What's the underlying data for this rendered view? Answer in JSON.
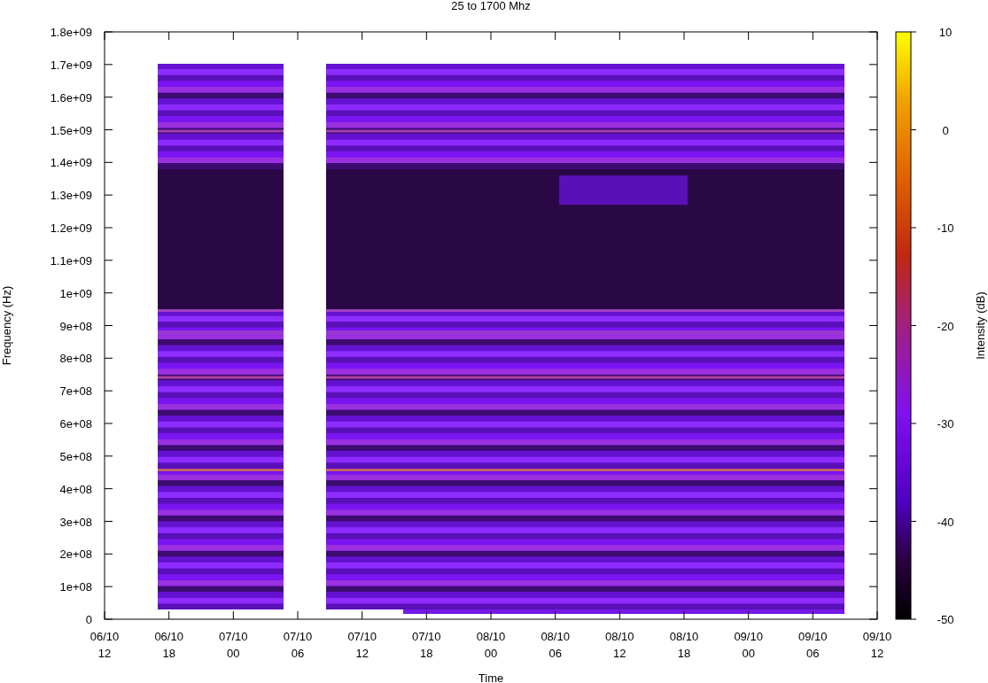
{
  "title": "25 to 1700 Mhz",
  "y_axis": {
    "label": "Frequency (Hz)",
    "ticks": [
      "1.8e+09",
      "1.7e+09",
      "1.6e+09",
      "1.5e+09",
      "1.4e+09",
      "1.3e+09",
      "1.2e+09",
      "1.1e+09",
      "1e+09",
      "9e+08",
      "8e+08",
      "7e+08",
      "6e+08",
      "5e+08",
      "4e+08",
      "3e+08",
      "2e+08",
      "1e+08",
      "0"
    ]
  },
  "x_axis": {
    "label": "Time",
    "ticks": [
      {
        "date": "06/10",
        "hour": "12"
      },
      {
        "date": "06/10",
        "hour": "18"
      },
      {
        "date": "07/10",
        "hour": "00"
      },
      {
        "date": "07/10",
        "hour": "06"
      },
      {
        "date": "07/10",
        "hour": "12"
      },
      {
        "date": "07/10",
        "hour": "18"
      },
      {
        "date": "08/10",
        "hour": "00"
      },
      {
        "date": "08/10",
        "hour": "06"
      },
      {
        "date": "08/10",
        "hour": "12"
      },
      {
        "date": "08/10",
        "hour": "18"
      },
      {
        "date": "09/10",
        "hour": "00"
      },
      {
        "date": "09/10",
        "hour": "06"
      },
      {
        "date": "09/10",
        "hour": "12"
      }
    ]
  },
  "colorbar": {
    "label": "Intensity (dB)",
    "ticks": [
      "10",
      "0",
      "-10",
      "-20",
      "-30",
      "-40",
      "-50"
    ]
  }
}
